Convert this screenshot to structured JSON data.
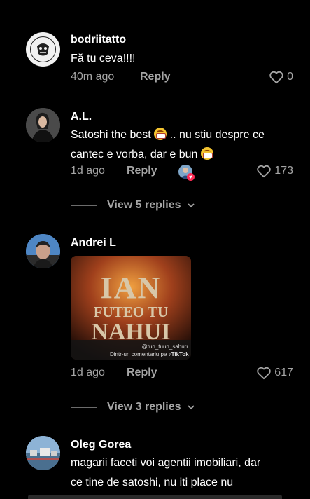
{
  "comments": [
    {
      "username": "bodriitatto",
      "text": "Fă tu ceva!!!!",
      "time": "40m ago",
      "reply_label": "Reply",
      "likes": "0",
      "avatar_icon": "tattoo-logo-avatar",
      "avatar_text": "BODRIITATTO"
    },
    {
      "username": "A.L.",
      "text_line1": "Satoshi the best",
      "text_line1_after": " .. nu stiu despre ce",
      "text_line2": "cantec e vorba, dar e bun",
      "time": "1d ago",
      "reply_label": "Reply",
      "likes": "173",
      "view_replies": "View 5 replies"
    },
    {
      "username": "Andrei L",
      "media_line1": "IAN",
      "media_line2": "FUTEO TU",
      "media_line3": "NAHUI",
      "media_handle": "@tun_tuun_sahurr",
      "media_caption": "Dintr-un comentariu pe",
      "media_brand": "TikTok",
      "time": "1d ago",
      "reply_label": "Reply",
      "likes": "617",
      "view_replies": "View 3 replies"
    },
    {
      "username": "Oleg Gorea",
      "text_line1": "magarii faceti voi agentii imobiliari, dar",
      "text_line2": "ce tine de satoshi, nu iti place nu"
    }
  ],
  "colors": {
    "background": "#000000",
    "text": "#ffffff",
    "secondary": "#a5a5a5",
    "emoji": "#f4c430",
    "liked_badge": "#fe2c55"
  }
}
